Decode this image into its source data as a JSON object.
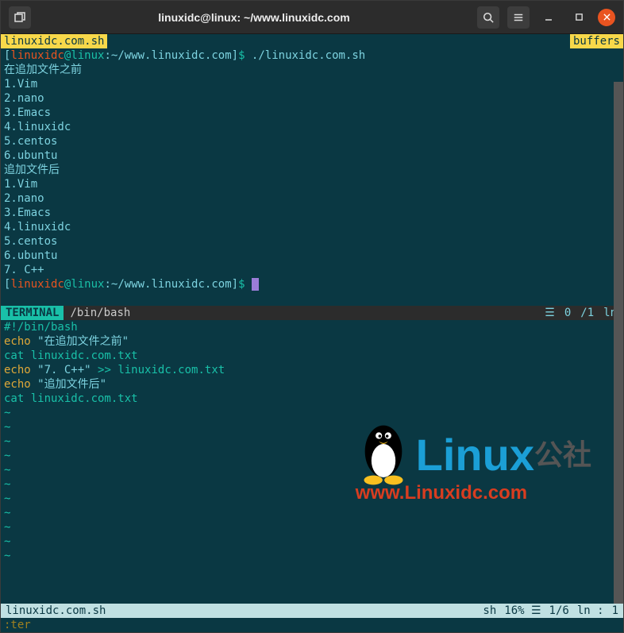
{
  "titlebar": {
    "title": "linuxidc@linux: ~/www.linuxidc.com"
  },
  "tabline": {
    "active_tab": "linuxidc.com.sh",
    "right_label": "buffers"
  },
  "prompt": {
    "open": "[",
    "user": "linuxidc",
    "at": "@",
    "host": "linux",
    "colon": ":",
    "path": "~/www.linuxidc.com",
    "close": "]",
    "sym": "$"
  },
  "term": {
    "cmd1": " ./linuxidc.com.sh",
    "l1": "在追加文件之前",
    "l2": "1.Vim",
    "l3": "2.nano",
    "l4": "3.Emacs",
    "l5": "4.linuxidc",
    "l6": "5.centos",
    "l7": "6.ubuntu",
    "l8": "追加文件后",
    "l9": "1.Vim",
    "l10": "2.nano",
    "l11": "3.Emacs",
    "l12": "4.linuxidc",
    "l13": "5.centos",
    "l14": "6.ubuntu",
    "l15": "7. C++"
  },
  "status_mid": {
    "mode": " TERMINAL ",
    "path": "/bin/bash",
    "pos": "0",
    "total": "/1",
    "ln": "ln"
  },
  "editor": {
    "l1": "#!/bin/bash",
    "l2a": "echo ",
    "l2b": "\"在追加文件之前\"",
    "l3": "cat linuxidc.com.txt",
    "l4a": "echo ",
    "l4b": "\"7. C++\"",
    "l4c": " >> ",
    "l4d": "linuxidc.com.txt",
    "l5a": "echo ",
    "l5b": "\"追加文件后\"",
    "l6": "cat linuxidc.com.txt",
    "tilde": "~"
  },
  "statusline": {
    "filename": " linuxidc.com.sh",
    "ft": "sh",
    "pct": "16% ☰",
    "pos": "1/6",
    "ln": "ln :",
    "col": "1"
  },
  "cmdline": ":ter",
  "watermark": {
    "linux": "Linux",
    "cn": "公社",
    "url": "www.Linuxidc.com"
  }
}
